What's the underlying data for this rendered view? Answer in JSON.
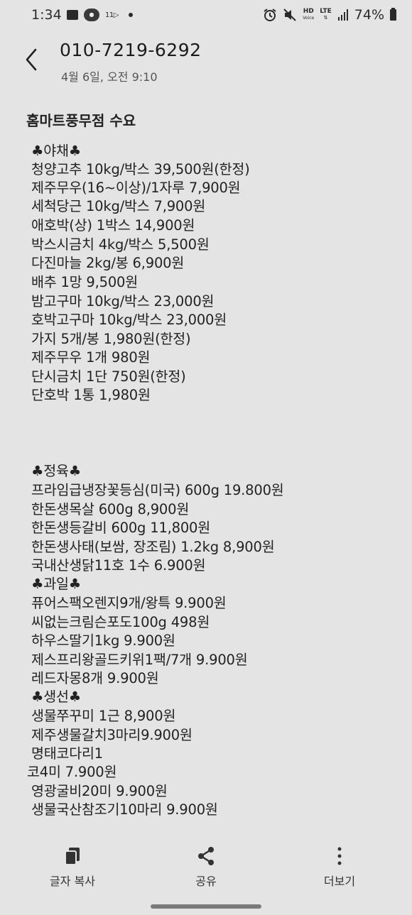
{
  "status_bar": {
    "time": "1:34",
    "network_label": "11▷",
    "status_hd": "HD",
    "status_voice": "Voice",
    "status_lte": "LTE",
    "battery": "74%"
  },
  "header": {
    "title": "010-7219-6292",
    "subtitle": "4월 6일, 오전 9:10"
  },
  "message": {
    "heading": "홈마트풍무점 수요",
    "lines": [
      "♣야채♣",
      "청양고추 10kg/박스 39,500원(한정)",
      "제주무우(16~이상)/1자루 7,900원",
      "세척당근 10kg/박스 7,900원",
      "애호박(상) 1박스 14,900원",
      "박스시금치 4kg/박스 5,500원",
      "다진마늘 2kg/봉 6,900원",
      "배추 1망 9,500원",
      "밤고구마 10kg/박스 23,000원",
      "호박고구마 10kg/박스 23,000원",
      "가지 5개/봉 1,980원(한정)",
      "제주무우 1개 980원",
      "단시금치 1단 750원(한정)",
      "단호박 1통 1,980원",
      "♣정육♣",
      "프라임급냉장꽃등심(미국) 600g 19.800원",
      "한돈생목살 600g 8,900원",
      "한돈생등갈비 600g 11,800원",
      "한돈생사태(보쌈, 장조림) 1.2kg 8,900원",
      "국내산생닭11호 1수 6.900원",
      "♣과일♣",
      "퓨어스팩오렌지9개/왕특 9.900원",
      "씨없는크림슨포도100g 498원",
      "하우스딸기1kg 9.900원",
      "제스프리왕골드키위1팩/7개 9.900원",
      "레드자몽8개 9.900원",
      "♣생선♣",
      "생물쭈꾸미 1근 8,900원",
      "제주생물갈치3마리9.900원",
      "명태코다리1",
      "코4미 7.900원",
      "영광굴비20미 9.900원",
      "생물국산참조기10마리 9.900원"
    ]
  },
  "bottom_bar": {
    "copy_text_label": "글자 복사",
    "share_label": "공유",
    "more_label": "더보기"
  }
}
